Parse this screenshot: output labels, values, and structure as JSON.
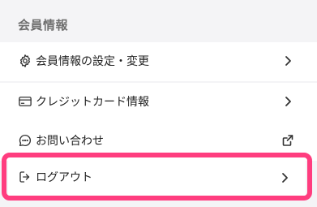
{
  "section": {
    "title": "会員情報"
  },
  "menu": {
    "items": [
      {
        "label": "会員情報の設定・変更",
        "icon": "gear-icon",
        "trail": "chevron-right-icon"
      },
      {
        "label": "クレジットカード情報",
        "icon": "credit-card-icon",
        "trail": "chevron-right-icon"
      },
      {
        "label": "お問い合わせ",
        "icon": "chat-bubble-icon",
        "trail": "external-link-icon"
      },
      {
        "label": "ログアウト",
        "icon": "logout-icon",
        "trail": "chevron-right-icon"
      }
    ]
  },
  "colors": {
    "background": "#f4f4f6",
    "row": "#ffffff",
    "highlight": "#ff3d7f",
    "text": "#222222",
    "header_text": "#707070"
  }
}
